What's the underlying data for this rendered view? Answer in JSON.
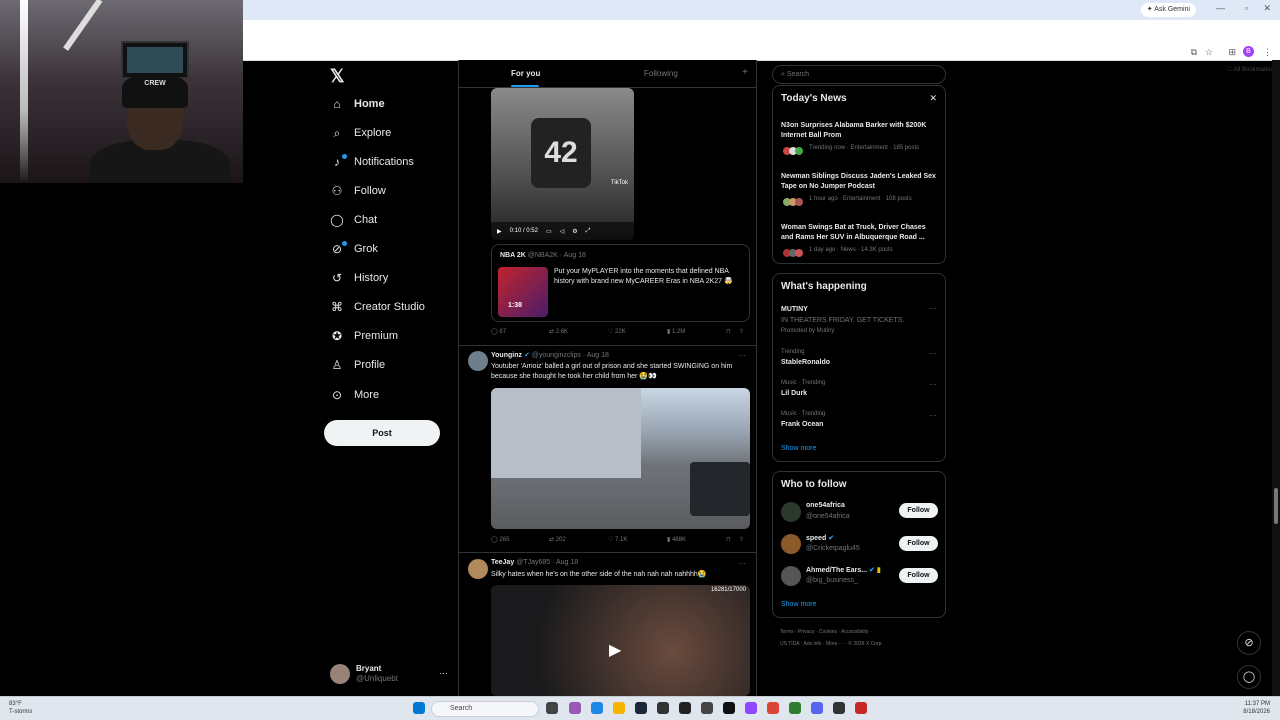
{
  "browser": {
    "ask_gemini": "Ask Gemini",
    "all_bookmarks": "All Bookmarks",
    "profile_initial": "B"
  },
  "webcam": {
    "cap_text": "CREW"
  },
  "nav": {
    "items": [
      {
        "label": "Home",
        "icon": "home-icon"
      },
      {
        "label": "Explore",
        "icon": "search-icon"
      },
      {
        "label": "Notifications",
        "icon": "bell-icon"
      },
      {
        "label": "Follow",
        "icon": "add-person-icon"
      },
      {
        "label": "Chat",
        "icon": "chat-icon"
      },
      {
        "label": "Grok",
        "icon": "grok-icon"
      },
      {
        "label": "History",
        "icon": "history-icon"
      },
      {
        "label": "Creator Studio",
        "icon": "creator-studio-icon"
      },
      {
        "label": "Premium",
        "icon": "premium-icon"
      },
      {
        "label": "Profile",
        "icon": "person-icon"
      },
      {
        "label": "More",
        "icon": "more-icon"
      }
    ],
    "post_label": "Post",
    "account": {
      "name": "Bryant",
      "handle": "@Unliquebt"
    }
  },
  "feed": {
    "tabs": [
      "For you",
      "Following"
    ],
    "post1": {
      "jersey_number": "42",
      "tiktok_label": "TikTok",
      "video_time": "0:10 / 0:52",
      "quote": {
        "author": "NBA 2K",
        "handle": "@NBA2K",
        "date": "· Aug 18",
        "text": "Put your MyPLAYER into the moments that defined NBA history with brand new MyCAREER Eras in NBA 2K27 🤯",
        "thumb_time": "1:38"
      },
      "stats": {
        "replies": "87",
        "reposts": "2.6K",
        "likes": "22K",
        "views": "1.2M"
      }
    },
    "post2": {
      "author": "Younginz",
      "handle": "@younginzclips",
      "date": "· Aug 18",
      "text": "Youtuber 'Amoiz' balled a girl out of prison and she started SWINGING on him because she thought he took her child from her 😭👀",
      "stats": {
        "replies": "265",
        "reposts": "202",
        "likes": "7.1K",
        "views": "488K"
      }
    },
    "post3": {
      "author": "TeeJay",
      "handle": "@TJay685",
      "date": "· Aug 18",
      "text": "Silky hates when he's on the other side of the nah nah nah nahhhh😭",
      "score": "16281/17000"
    }
  },
  "sidebar": {
    "search_placeholder": "Search",
    "news": {
      "title": "Today's News",
      "items": [
        {
          "title": "N3on Surprises Alabama Barker with $200K Internet Ball Prom",
          "meta": "Trending now · Entertainment · 185 posts"
        },
        {
          "title": "Newman Siblings Discuss Jaden's Leaked Sex Tape on No Jumper Podcast",
          "meta": "1 hour ago · Entertainment · 108 posts"
        },
        {
          "title": "Woman Swings Bat at Truck, Driver Chases and Rams Her SUV in Albuquerque Road ...",
          "meta": "1 day ago · News · 14.3K posts"
        }
      ]
    },
    "happening": {
      "title": "What's happening",
      "items": [
        {
          "label": "",
          "title": "MUTINY",
          "sub": "IN THEATERS FRIDAY. GET TICKETS.",
          "extra": "Promoted by Mutiny"
        },
        {
          "label": "Trending",
          "title": "StableRonaldo"
        },
        {
          "label": "Music · Trending",
          "title": "Lil Durk"
        },
        {
          "label": "Music · Trending",
          "title": "Frank Ocean"
        }
      ],
      "show_more": "Show more"
    },
    "who_to_follow": {
      "title": "Who to follow",
      "items": [
        {
          "name": "one54africa",
          "handle": "@one54africa"
        },
        {
          "name": "speed",
          "handle": "@Cricketpaglu45"
        },
        {
          "name": "Ahmed/The Ears...",
          "handle": "@big_business_"
        }
      ],
      "follow_label": "Follow",
      "show_more": "Show more"
    },
    "footer": {
      "line1": "Terms · Privacy · Cookies · Accessibility ·",
      "line2": "US TIDA · Ads info · More ··· · © 2026 X Corp."
    }
  },
  "taskbar": {
    "temp": "83°F",
    "weather": "T-storms",
    "search": "Search",
    "time": "11:37 PM",
    "date": "8/18/2026"
  },
  "colors": {
    "accent": "#1d9bf0",
    "bg": "#000000",
    "border": "#2f3336",
    "muted": "#71767b"
  }
}
